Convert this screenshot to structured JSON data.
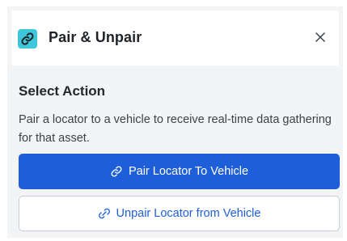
{
  "dialog": {
    "title": "Pair & Unpair",
    "title_icon": "link-icon",
    "close_icon": "close-icon"
  },
  "section": {
    "title": "Select Action",
    "description": "Pair a locator to a vehicle to receive real-time data gathering for that asset."
  },
  "actions": {
    "pair": {
      "label": "Pair Locator To Vehicle",
      "icon": "link-icon"
    },
    "unpair": {
      "label": "Unpair Locator from Vehicle",
      "icon": "unlink-icon"
    }
  },
  "colors": {
    "accent": "#1e5fd9",
    "icon_background": "#3ec7d9",
    "panel_background": "#f3f4f6"
  }
}
